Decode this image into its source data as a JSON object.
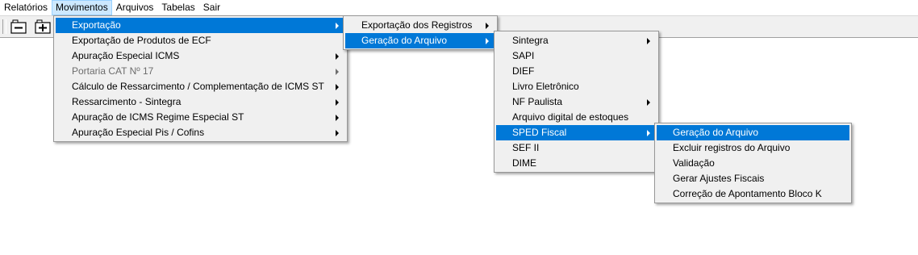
{
  "menubar": {
    "items": [
      "Relatórios",
      "Movimentos",
      "Arquivos",
      "Tabelas",
      "Sair"
    ]
  },
  "toolbar": {
    "buttons": [
      {
        "icon": "collapse-minus-icon"
      },
      {
        "icon": "expand-plus-icon"
      }
    ]
  },
  "menu1": {
    "items": [
      {
        "label": "Exportação",
        "submenu": true,
        "highlighted": true
      },
      {
        "label": "Exportação de Produtos de ECF",
        "submenu": false
      },
      {
        "label": "Apuração Especial ICMS",
        "submenu": true
      },
      {
        "label": "Portaria CAT Nº 17",
        "submenu": true,
        "disabled": true
      },
      {
        "label": "Cálculo de Ressarcimento / Complementação de ICMS ST",
        "submenu": true
      },
      {
        "label": "Ressarcimento - Sintegra",
        "submenu": true
      },
      {
        "label": "Apuração de ICMS Regime Especial ST",
        "submenu": true
      },
      {
        "label": "Apuração Especial Pis / Cofins",
        "submenu": true
      }
    ]
  },
  "menu2": {
    "items": [
      {
        "label": "Exportação dos Registros",
        "submenu": true
      },
      {
        "label": "Geração do Arquivo",
        "submenu": true,
        "highlighted": true
      }
    ]
  },
  "menu3": {
    "items": [
      {
        "label": "Sintegra",
        "submenu": true
      },
      {
        "label": "SAPI",
        "submenu": false
      },
      {
        "label": "DIEF",
        "submenu": false
      },
      {
        "label": "Livro Eletrônico",
        "submenu": false
      },
      {
        "label": "NF Paulista",
        "submenu": true
      },
      {
        "label": "Arquivo digital de estoques",
        "submenu": false
      },
      {
        "label": "SPED Fiscal",
        "submenu": true,
        "highlighted": true
      },
      {
        "label": "SEF II",
        "submenu": false
      },
      {
        "label": "DIME",
        "submenu": false
      }
    ]
  },
  "menu4": {
    "items": [
      {
        "label": "Geração do Arquivo",
        "highlighted": true
      },
      {
        "label": "Excluir registros do Arquivo"
      },
      {
        "label": "Validação"
      },
      {
        "label": "Gerar Ajustes Fiscais"
      },
      {
        "label": "Correção de Apontamento Bloco K"
      }
    ]
  },
  "colors": {
    "highlight": "#0078d7",
    "menu_bg": "#f0f0f0",
    "active_menubar": "#cce8ff"
  }
}
